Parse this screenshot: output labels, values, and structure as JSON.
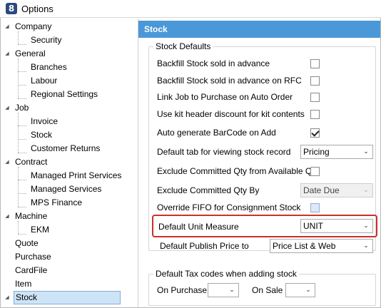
{
  "window": {
    "title": "Options",
    "icon": "app-logo-icon",
    "icon_glyph": "8"
  },
  "tree": {
    "items": [
      {
        "label": "Company",
        "level": 0,
        "expanded": true
      },
      {
        "label": "Security",
        "level": 1
      },
      {
        "label": "General",
        "level": 0,
        "expanded": true
      },
      {
        "label": "Branches",
        "level": 1
      },
      {
        "label": "Labour",
        "level": 1
      },
      {
        "label": "Regional Settings",
        "level": 1
      },
      {
        "label": "Job",
        "level": 0,
        "expanded": true
      },
      {
        "label": "Invoice",
        "level": 1
      },
      {
        "label": "Stock",
        "level": 1
      },
      {
        "label": "Customer Returns",
        "level": 1
      },
      {
        "label": "Contract",
        "level": 0,
        "expanded": true
      },
      {
        "label": "Managed Print Services",
        "level": 1
      },
      {
        "label": "Managed Services",
        "level": 1
      },
      {
        "label": "MPS Finance",
        "level": 1
      },
      {
        "label": "Machine",
        "level": 0,
        "expanded": true
      },
      {
        "label": "EKM",
        "level": 1
      },
      {
        "label": "Quote",
        "level": 0
      },
      {
        "label": "Purchase",
        "level": 0
      },
      {
        "label": "CardFile",
        "level": 0
      },
      {
        "label": "Item",
        "level": 0
      },
      {
        "label": "Stock",
        "level": 0,
        "expanded": true,
        "selected": true
      }
    ]
  },
  "panel": {
    "header": "Stock",
    "stock_defaults": {
      "title": "Stock Defaults",
      "backfill_advance": {
        "label": "Backfill Stock sold in advance",
        "checked": false
      },
      "backfill_rfc": {
        "label": "Backfill Stock sold in advance on RFC",
        "checked": false
      },
      "link_job": {
        "label": "Link Job to Purchase on Auto Order",
        "checked": false
      },
      "kit_discount": {
        "label": "Use kit header discount for kit contents",
        "checked": false
      },
      "auto_barcode": {
        "label": "Auto generate BarCode on Add",
        "checked": true
      },
      "default_tab": {
        "label": "Default tab for viewing stock record",
        "value": "Pricing"
      },
      "exclude_committed": {
        "label": "Exclude Committed Qty from Available Qty",
        "checked": false
      },
      "exclude_committed_by": {
        "label": "Exclude Committed Qty By",
        "value": "Date Due",
        "disabled": true
      },
      "override_fifo": {
        "label": "Override FIFO for Consignment Stock",
        "checked": false,
        "disabled": true
      },
      "default_unit": {
        "label": "Default Unit Measure",
        "value": "UNIT"
      },
      "default_publish": {
        "label": "Default Publish Price to",
        "value": "Price List & Web"
      }
    },
    "tax_codes": {
      "title": "Default Tax codes when adding stock",
      "on_purchase": {
        "label": "On Purchase",
        "value": ""
      },
      "on_sale": {
        "label": "On Sale",
        "value": ""
      }
    }
  },
  "colors": {
    "header_bg": "#4a98d8",
    "highlight_border": "#c8312b",
    "selection_bg": "#cde4f7"
  }
}
